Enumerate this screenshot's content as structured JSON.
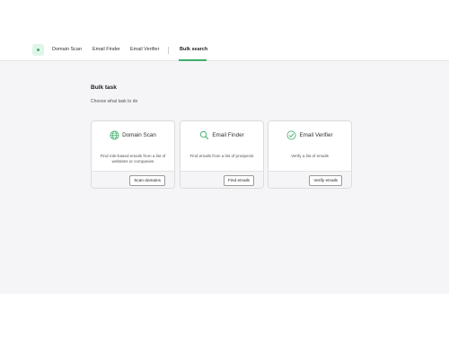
{
  "nav": {
    "items": [
      {
        "label": "Domain Scan"
      },
      {
        "label": "Email Finder"
      },
      {
        "label": "Email Verifier"
      },
      {
        "label": "Bulk search"
      }
    ],
    "active": "Bulk search",
    "accent": "#3fae6a"
  },
  "main": {
    "title": "Bulk task",
    "subtitle": "Choose what task to do",
    "cards": [
      {
        "icon": "globe-icon",
        "title": "Domain Scan",
        "description": "Find role-based emails from a list of websites or companies",
        "button": "Scan domains"
      },
      {
        "icon": "search-icon",
        "title": "Email Finder",
        "description": "Find emails from a list of prospects",
        "button": "Find emails"
      },
      {
        "icon": "check-circle-icon",
        "title": "Email Verifier",
        "description": "Verify a list of emails",
        "button": "Verify emails"
      }
    ]
  }
}
